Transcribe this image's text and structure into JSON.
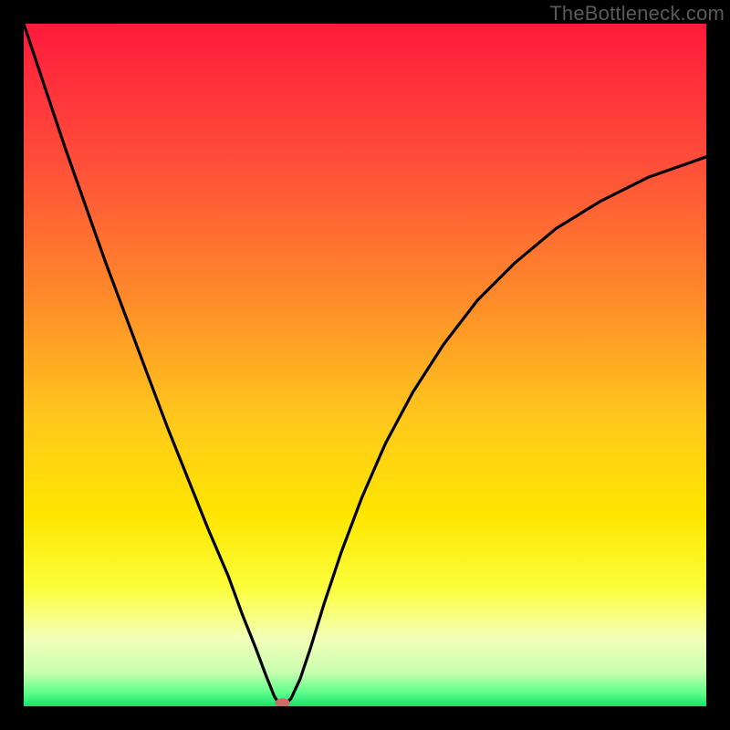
{
  "watermark": "TheBottleneck.com",
  "chart_data": {
    "type": "line",
    "title": "",
    "xlabel": "",
    "ylabel": "",
    "xlim": [
      0,
      100
    ],
    "ylim": [
      0,
      100
    ],
    "grid": false,
    "legend": false,
    "gradient_stops": [
      {
        "offset": 0,
        "color": "#ff1a3c"
      },
      {
        "offset": 20,
        "color": "#ff4d3a"
      },
      {
        "offset": 40,
        "color": "#ff8a2a"
      },
      {
        "offset": 58,
        "color": "#ffc81c"
      },
      {
        "offset": 72,
        "color": "#ffe600"
      },
      {
        "offset": 83,
        "color": "#fbff3f"
      },
      {
        "offset": 90,
        "color": "#f3ffb8"
      },
      {
        "offset": 95,
        "color": "#c9ffb0"
      },
      {
        "offset": 98,
        "color": "#5eff8a"
      },
      {
        "offset": 100,
        "color": "#18e06a"
      }
    ],
    "curve_points_pct": [
      {
        "x": 0.0,
        "y": 100.0
      },
      {
        "x": 3.0,
        "y": 91.0
      },
      {
        "x": 6.0,
        "y": 82.0
      },
      {
        "x": 9.0,
        "y": 73.5
      },
      {
        "x": 12.0,
        "y": 65.0
      },
      {
        "x": 15.0,
        "y": 57.0
      },
      {
        "x": 18.0,
        "y": 49.0
      },
      {
        "x": 21.0,
        "y": 41.0
      },
      {
        "x": 24.0,
        "y": 33.5
      },
      {
        "x": 27.0,
        "y": 26.0
      },
      {
        "x": 30.0,
        "y": 19.0
      },
      {
        "x": 32.0,
        "y": 13.5
      },
      {
        "x": 34.0,
        "y": 8.5
      },
      {
        "x": 35.5,
        "y": 4.5
      },
      {
        "x": 36.7,
        "y": 1.5
      },
      {
        "x": 37.5,
        "y": 0.2
      },
      {
        "x": 38.3,
        "y": 0.2
      },
      {
        "x": 39.2,
        "y": 1.2
      },
      {
        "x": 40.5,
        "y": 4.0
      },
      {
        "x": 42.0,
        "y": 8.5
      },
      {
        "x": 44.0,
        "y": 15.0
      },
      {
        "x": 46.5,
        "y": 22.5
      },
      {
        "x": 49.5,
        "y": 30.5
      },
      {
        "x": 53.0,
        "y": 38.5
      },
      {
        "x": 57.0,
        "y": 46.0
      },
      {
        "x": 61.5,
        "y": 53.0
      },
      {
        "x": 66.5,
        "y": 59.5
      },
      {
        "x": 72.0,
        "y": 65.0
      },
      {
        "x": 78.0,
        "y": 70.0
      },
      {
        "x": 84.5,
        "y": 74.0
      },
      {
        "x": 91.5,
        "y": 77.5
      },
      {
        "x": 100.0,
        "y": 80.5
      }
    ],
    "marker": {
      "x_pct": 37.9,
      "y_pct": 0.5,
      "color": "#d06a6a",
      "rx": 8,
      "ry": 5
    }
  }
}
